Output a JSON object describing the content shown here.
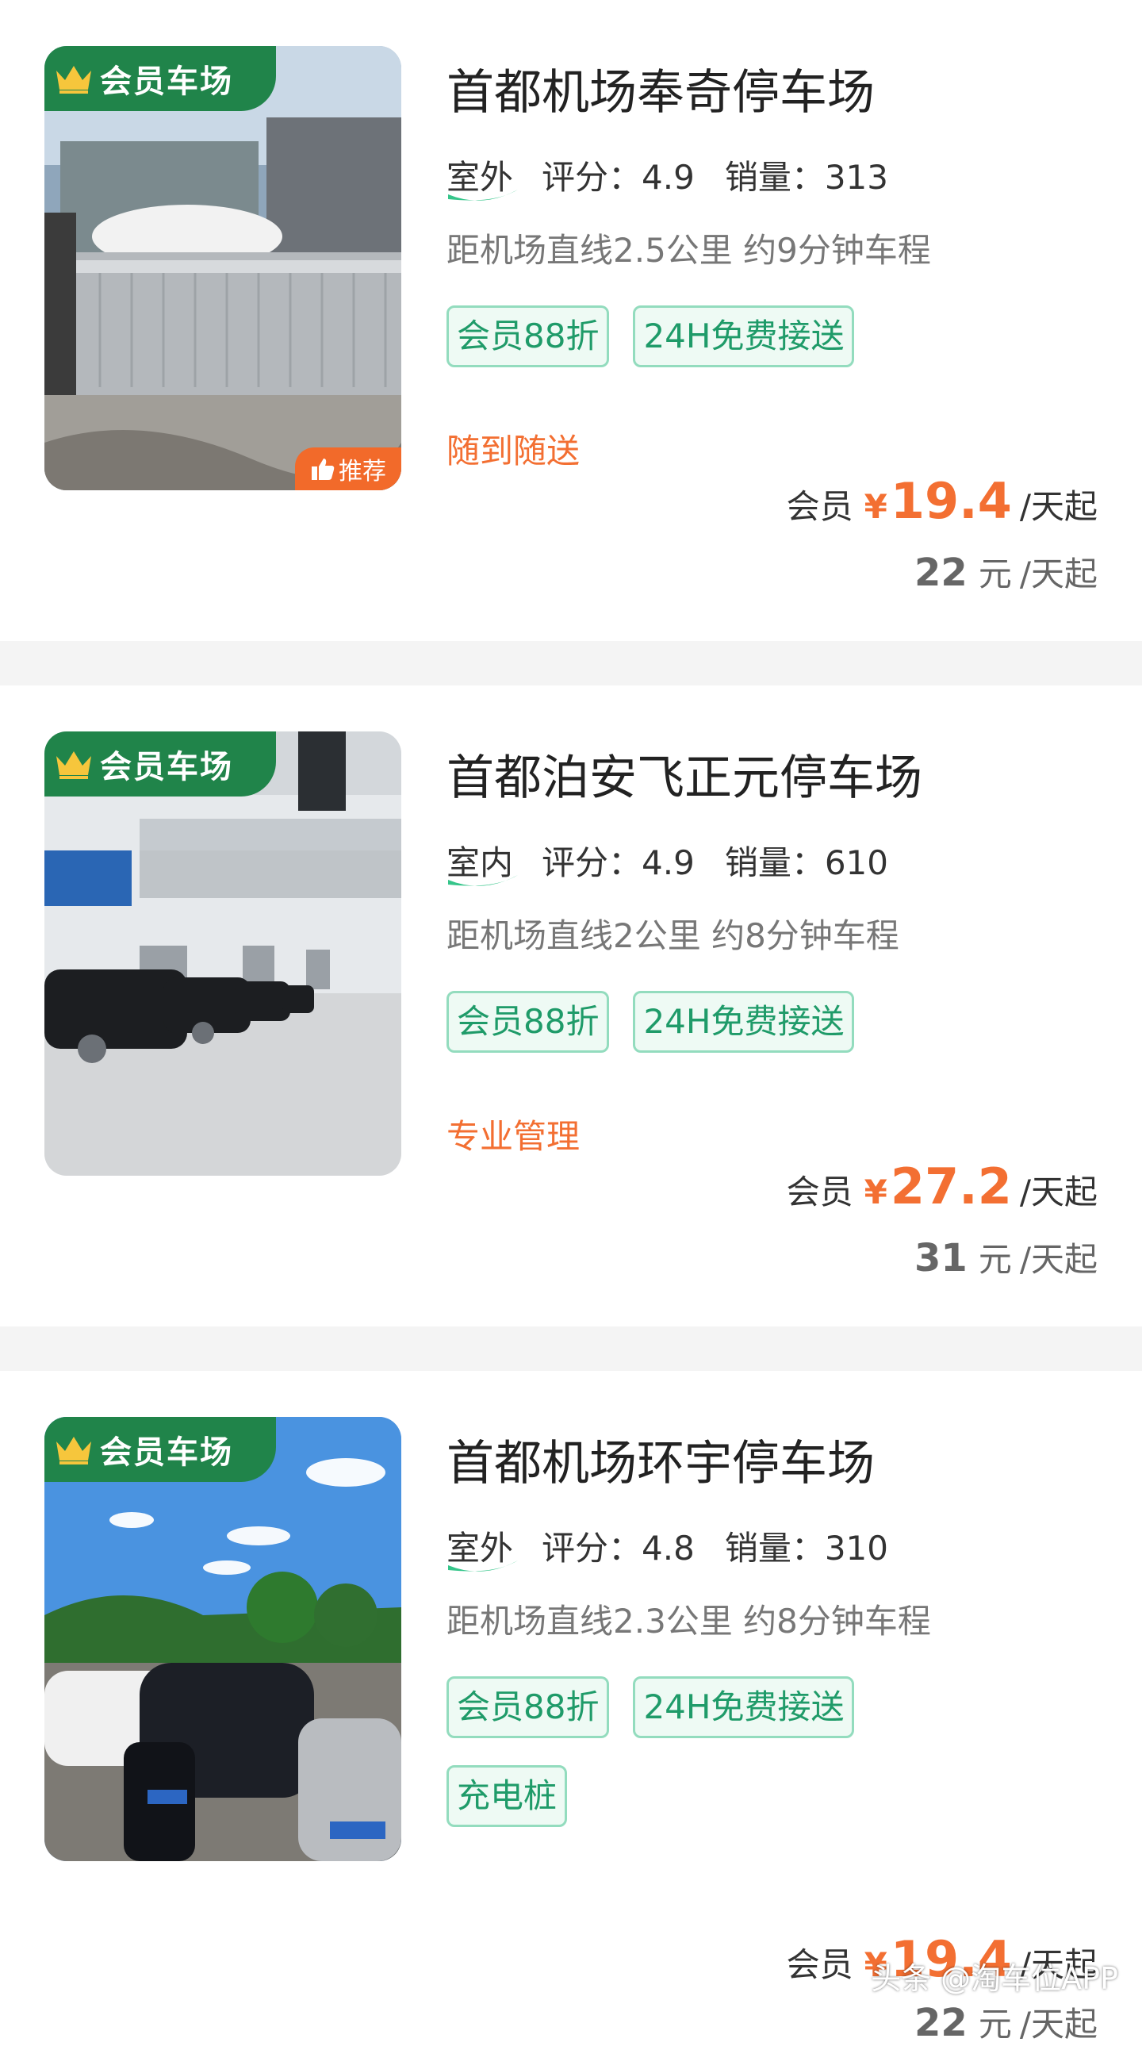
{
  "colors": {
    "brand_green": "#20844a",
    "accent_orange": "#f36f32",
    "tag_green": "#1f9b69"
  },
  "listings": [
    {
      "badge": "会员车场",
      "recommend": "推荐",
      "title": "首都机场奉奇停车场",
      "kind": "室外",
      "rating": "评分：4.9",
      "sales": "销量：313",
      "distance": "距机场直线2.5公里 约9分钟车程",
      "tags": [
        "会员88折",
        "24H免费接送"
      ],
      "feature": "随到随送",
      "member_label": "会员",
      "currency": "¥",
      "member_price": "19.4",
      "unit": "/天起",
      "original_price": "22",
      "original_currency": "元",
      "original_unit": "/天起",
      "photo": "outdoor-gate-photo"
    },
    {
      "badge": "会员车场",
      "title": "首都泊安飞正元停车场",
      "kind": "室内",
      "rating": "评分：4.9",
      "sales": "销量：610",
      "distance": "距机场直线2公里 约8分钟车程",
      "tags": [
        "会员88折",
        "24H免费接送"
      ],
      "feature": "专业管理",
      "member_label": "会员",
      "currency": "¥",
      "member_price": "27.2",
      "unit": "/天起",
      "original_price": "31",
      "original_currency": "元",
      "original_unit": "/天起",
      "photo": "indoor-garage-photo"
    },
    {
      "badge": "会员车场",
      "title": "首都机场环宇停车场",
      "kind": "室外",
      "rating": "评分：4.8",
      "sales": "销量：310",
      "distance": "距机场直线2.3公里 约8分钟车程",
      "tags": [
        "会员88折",
        "24H免费接送"
      ],
      "tags2": [
        "充电桩"
      ],
      "member_label": "会员",
      "currency": "¥",
      "member_price": "19.4",
      "unit": "/天起",
      "original_price": "22",
      "original_currency": "元",
      "original_unit": "/天起",
      "photo": "outdoor-lot-photo"
    }
  ],
  "watermark": "头条 @淘车位APP"
}
